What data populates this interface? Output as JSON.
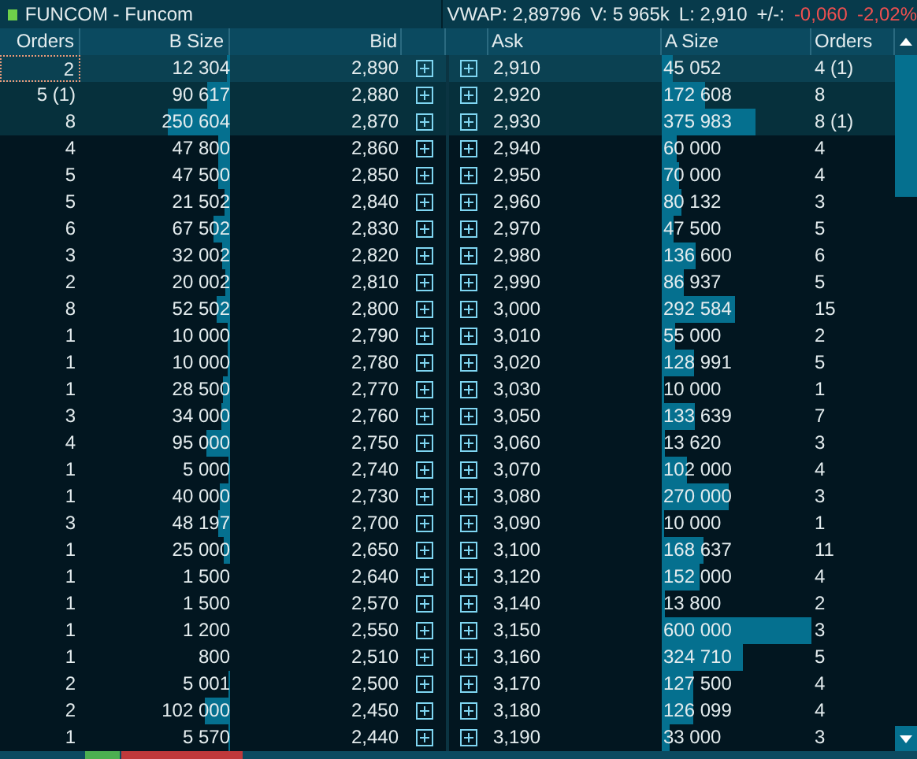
{
  "window": {
    "title": "FUNCOM - Funcom"
  },
  "stats": [
    {
      "text": "VWAP: 2,89796",
      "negative": false
    },
    {
      "text": "V: 5 965k",
      "negative": false
    },
    {
      "text": "L: 2,910",
      "negative": false
    },
    {
      "text": "+/-:",
      "negative": false
    },
    {
      "text": "-0,060",
      "negative": true
    },
    {
      "text": "-2,02%",
      "negative": true
    }
  ],
  "columns": [
    "Orders",
    "B Size",
    "Bid",
    "Ask",
    "A Size",
    "Orders"
  ],
  "rows": [
    {
      "orders": "2",
      "b_size": {
        "text": "12 304"
      },
      "bid": "2,890",
      "ask": "2,910",
      "a_size": {
        "text": "45 052"
      },
      "a_orders": "4 (1)",
      "highlighted": true,
      "focused": true
    },
    {
      "orders": "5 (1)",
      "b_size": {
        "text": "90 617"
      },
      "bid": "2,880",
      "ask": "2,920",
      "a_size": {
        "text": "172 608"
      },
      "a_orders": "8",
      "highlighted": true,
      "focused": false
    },
    {
      "orders": "8",
      "b_size": {
        "text": "250 604"
      },
      "bid": "2,870",
      "ask": "2,930",
      "a_size": {
        "text": "375 983"
      },
      "a_orders": "8 (1)",
      "highlighted": true,
      "focused": false
    },
    {
      "orders": "4",
      "b_size": {
        "text": "47 800"
      },
      "bid": "2,860",
      "ask": "2,940",
      "a_size": {
        "text": "60 000"
      },
      "a_orders": "4",
      "highlighted": false,
      "focused": false
    },
    {
      "orders": "5",
      "b_size": {
        "text": "47 500"
      },
      "bid": "2,850",
      "ask": "2,950",
      "a_size": {
        "text": "70 000"
      },
      "a_orders": "4",
      "highlighted": false,
      "focused": false
    },
    {
      "orders": "5",
      "b_size": {
        "text": "21 502"
      },
      "bid": "2,840",
      "ask": "2,960",
      "a_size": {
        "text": "80 132"
      },
      "a_orders": "3",
      "highlighted": false,
      "focused": false
    },
    {
      "orders": "6",
      "b_size": {
        "text": "67 502"
      },
      "bid": "2,830",
      "ask": "2,970",
      "a_size": {
        "text": "47 500"
      },
      "a_orders": "5",
      "highlighted": false,
      "focused": false
    },
    {
      "orders": "3",
      "b_size": {
        "text": "32 002"
      },
      "bid": "2,820",
      "ask": "2,980",
      "a_size": {
        "text": "136 600"
      },
      "a_orders": "6",
      "highlighted": false,
      "focused": false
    },
    {
      "orders": "2",
      "b_size": {
        "text": "20 002"
      },
      "bid": "2,810",
      "ask": "2,990",
      "a_size": {
        "text": "86 937"
      },
      "a_orders": "5",
      "highlighted": false,
      "focused": false
    },
    {
      "orders": "8",
      "b_size": {
        "text": "52 502"
      },
      "bid": "2,800",
      "ask": "3,000",
      "a_size": {
        "text": "292 584"
      },
      "a_orders": "15",
      "highlighted": false,
      "focused": false
    },
    {
      "orders": "1",
      "b_size": {
        "text": "10 000"
      },
      "bid": "2,790",
      "ask": "3,010",
      "a_size": {
        "text": "55 000"
      },
      "a_orders": "2",
      "highlighted": false,
      "focused": false
    },
    {
      "orders": "1",
      "b_size": {
        "text": "10 000"
      },
      "bid": "2,780",
      "ask": "3,020",
      "a_size": {
        "text": "128 991"
      },
      "a_orders": "5",
      "highlighted": false,
      "focused": false
    },
    {
      "orders": "1",
      "b_size": {
        "text": "28 500"
      },
      "bid": "2,770",
      "ask": "3,030",
      "a_size": {
        "text": "10 000"
      },
      "a_orders": "1",
      "highlighted": false,
      "focused": false
    },
    {
      "orders": "3",
      "b_size": {
        "text": "34 000"
      },
      "bid": "2,760",
      "ask": "3,050",
      "a_size": {
        "text": "133 639"
      },
      "a_orders": "7",
      "highlighted": false,
      "focused": false
    },
    {
      "orders": "4",
      "b_size": {
        "text": "95 000"
      },
      "bid": "2,750",
      "ask": "3,060",
      "a_size": {
        "text": "13 620"
      },
      "a_orders": "3",
      "highlighted": false,
      "focused": false
    },
    {
      "orders": "1",
      "b_size": {
        "text": "5 000"
      },
      "bid": "2,740",
      "ask": "3,070",
      "a_size": {
        "text": "102 000"
      },
      "a_orders": "4",
      "highlighted": false,
      "focused": false
    },
    {
      "orders": "1",
      "b_size": {
        "text": "40 000"
      },
      "bid": "2,730",
      "ask": "3,080",
      "a_size": {
        "text": "270 000"
      },
      "a_orders": "3",
      "highlighted": false,
      "focused": false
    },
    {
      "orders": "3",
      "b_size": {
        "text": "48 197"
      },
      "bid": "2,700",
      "ask": "3,090",
      "a_size": {
        "text": "10 000"
      },
      "a_orders": "1",
      "highlighted": false,
      "focused": false
    },
    {
      "orders": "1",
      "b_size": {
        "text": "25 000"
      },
      "bid": "2,650",
      "ask": "3,100",
      "a_size": {
        "text": "168 637"
      },
      "a_orders": "11",
      "highlighted": false,
      "focused": false
    },
    {
      "orders": "1",
      "b_size": {
        "text": "1 500"
      },
      "bid": "2,640",
      "ask": "3,120",
      "a_size": {
        "text": "152 000"
      },
      "a_orders": "4",
      "highlighted": false,
      "focused": false
    },
    {
      "orders": "1",
      "b_size": {
        "text": "1 500"
      },
      "bid": "2,570",
      "ask": "3,140",
      "a_size": {
        "text": "13 800"
      },
      "a_orders": "2",
      "highlighted": false,
      "focused": false
    },
    {
      "orders": "1",
      "b_size": {
        "text": "1 200"
      },
      "bid": "2,550",
      "ask": "3,150",
      "a_size": {
        "text": "600 000"
      },
      "a_orders": "3",
      "highlighted": false,
      "focused": false
    },
    {
      "orders": "1",
      "b_size": {
        "text": "800"
      },
      "bid": "2,510",
      "ask": "3,160",
      "a_size": {
        "text": "324 710"
      },
      "a_orders": "5",
      "highlighted": false,
      "focused": false
    },
    {
      "orders": "2",
      "b_size": {
        "text": "5 001"
      },
      "bid": "2,500",
      "ask": "3,170",
      "a_size": {
        "text": "127 500"
      },
      "a_orders": "4",
      "highlighted": false,
      "focused": false
    },
    {
      "orders": "2",
      "b_size": {
        "text": "102 000"
      },
      "bid": "2,450",
      "ask": "3,180",
      "a_size": {
        "text": "126 099"
      },
      "a_orders": "4",
      "highlighted": false,
      "focused": false
    },
    {
      "orders": "1",
      "b_size": {
        "text": "5 570"
      },
      "bid": "2,440",
      "ask": "3,190",
      "a_size": {
        "text": "33 000"
      },
      "a_orders": "3",
      "highlighted": false,
      "focused": false
    }
  ]
}
